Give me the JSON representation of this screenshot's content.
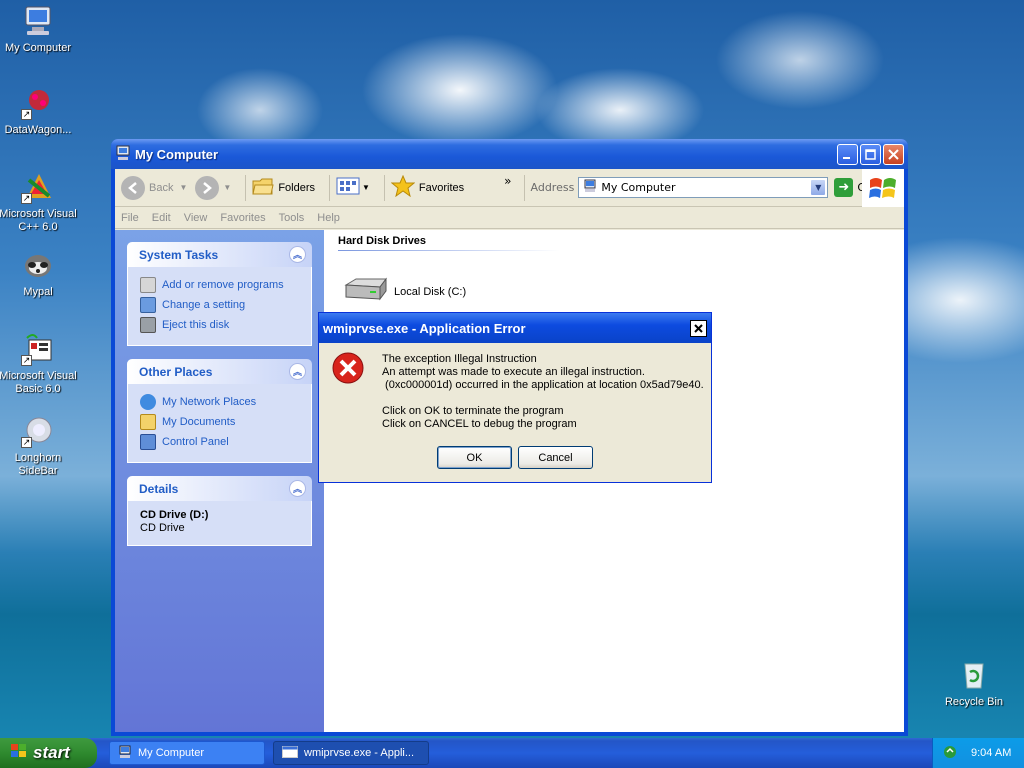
{
  "desktop": {
    "icons": [
      {
        "label": "My Computer"
      },
      {
        "label": "DataWagon..."
      },
      {
        "label": "Microsoft Visual C++ 6.0"
      },
      {
        "label": "Mypal"
      },
      {
        "label": "Microsoft Visual Basic 6.0"
      },
      {
        "label": "Longhorn SideBar"
      },
      {
        "label": "Recycle Bin"
      }
    ]
  },
  "window": {
    "title": "My Computer",
    "toolbar": {
      "back": "Back",
      "folders": "Folders",
      "favorites": "Favorites",
      "more": "»",
      "address_label": "Address",
      "address_value": "My Computer",
      "go": "Go"
    },
    "menu": [
      "File",
      "Edit",
      "View",
      "Favorites",
      "Tools",
      "Help"
    ],
    "taskpane": {
      "system_tasks": {
        "title": "System Tasks",
        "links": [
          "Add or remove programs",
          "Change a setting",
          "Eject this disk"
        ]
      },
      "other_places": {
        "title": "Other Places",
        "links": [
          "My Network Places",
          "My Documents",
          "Control Panel"
        ]
      },
      "details": {
        "title": "Details",
        "name": "CD Drive (D:)",
        "type": "CD Drive"
      }
    },
    "content": {
      "group_title": "Hard Disk Drives",
      "drive_label": "Local Disk (C:)"
    }
  },
  "dialog": {
    "title": "wmiprvse.exe - Application Error",
    "message": "The exception Illegal Instruction\nAn attempt was made to execute an illegal instruction.\n (0xc000001d) occurred in the application at location 0x5ad79e40.\n\nClick on OK to terminate the program\nClick on CANCEL to debug the program",
    "ok": "OK",
    "cancel": "Cancel"
  },
  "taskbar": {
    "start": "start",
    "tasks": [
      {
        "label": "My Computer"
      },
      {
        "label": "wmiprvse.exe - Appli..."
      }
    ],
    "clock": "9:04 AM"
  },
  "colors": {
    "xp_blue": "#0a49d6",
    "link_blue": "#215dc6",
    "error_red": "#d8241c",
    "start_green": "#2f8a2f"
  }
}
